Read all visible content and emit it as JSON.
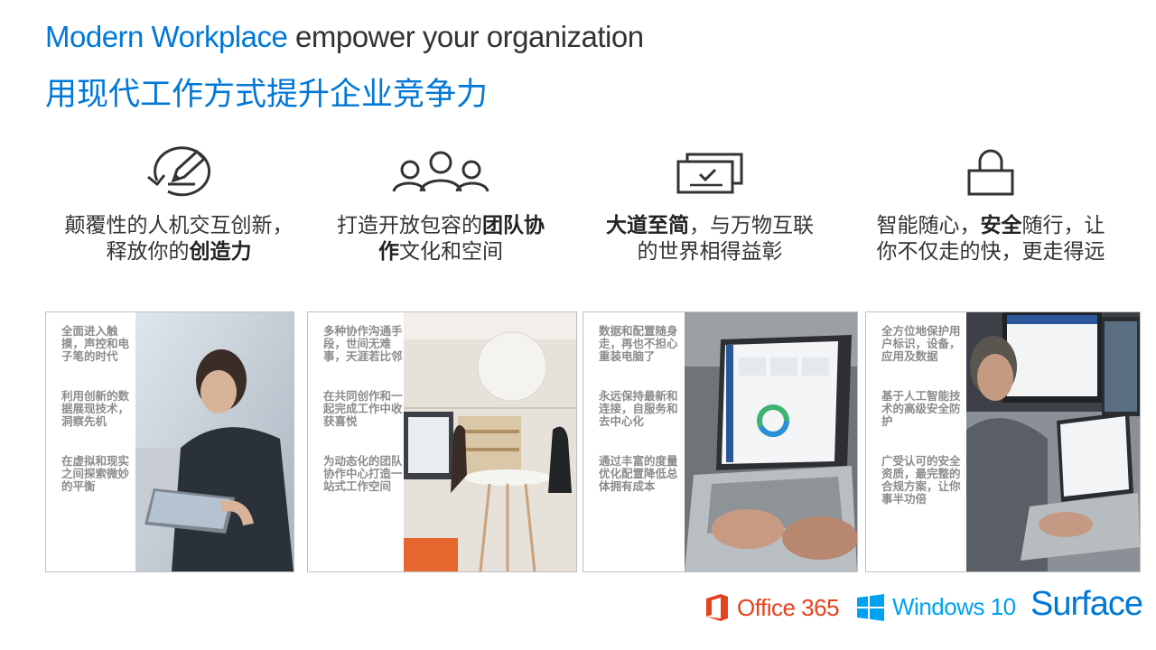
{
  "header": {
    "title_accent": "Modern Workplace",
    "title_rest": " empower your organization",
    "subtitle_cn": "用现代工作方式提升企业竞争力"
  },
  "features": [
    {
      "icon": "touch-pen-icon",
      "line1_a": "颠覆性的人机交互创新，",
      "line2_a": "释放你的",
      "line2_b": "创造力",
      "line2_c": ""
    },
    {
      "icon": "team-icon",
      "line1_a": "打造开放包容的",
      "line1_b": "团队协",
      "line2_a": "",
      "line2_b": "作",
      "line2_c": "文化和空间"
    },
    {
      "icon": "connected-devices-icon",
      "line1_a": "",
      "line1_b": "大道至简",
      "line1_c": "，与万物互联",
      "line2_a": "的世界相得益彰"
    },
    {
      "icon": "lock-icon",
      "line1_a": "智能随心，",
      "line1_b": "安全",
      "line1_c": "随行，让",
      "line2_a": "你不仅走的快，更走得远"
    }
  ],
  "cards": [
    {
      "bullets": [
        "全面进入触摸，声控和电子笔的时代",
        "利用创新的数据展现技术，洞察先机",
        "在虚拟和现实之间探索微妙的平衡"
      ]
    },
    {
      "bullets": [
        "多种协作沟通手段，世间无难事，天涯若比邻",
        "在共同创作和一起完成工作中收获喜悦",
        "为动态化的团队协作中心打造一站式工作空间"
      ]
    },
    {
      "bullets": [
        "数据和配置随身走，再也不担心重装电脑了",
        "永远保持最新和连接，自服务和去中心化",
        "通过丰富的度量优化配置降低总体拥有成本"
      ]
    },
    {
      "bullets": [
        "全方位地保护用户标识，设备，应用及数据",
        "基于人工智能技术的高级安全防护",
        "广受认可的安全资质，最完整的合规方案，让你事半功倍"
      ]
    }
  ],
  "logos": {
    "office": "Office 365",
    "windows": "Windows 10",
    "surface": "Surface"
  },
  "colors": {
    "accent": "#0078d7",
    "office": "#e6421e",
    "windows": "#00a1f1"
  }
}
